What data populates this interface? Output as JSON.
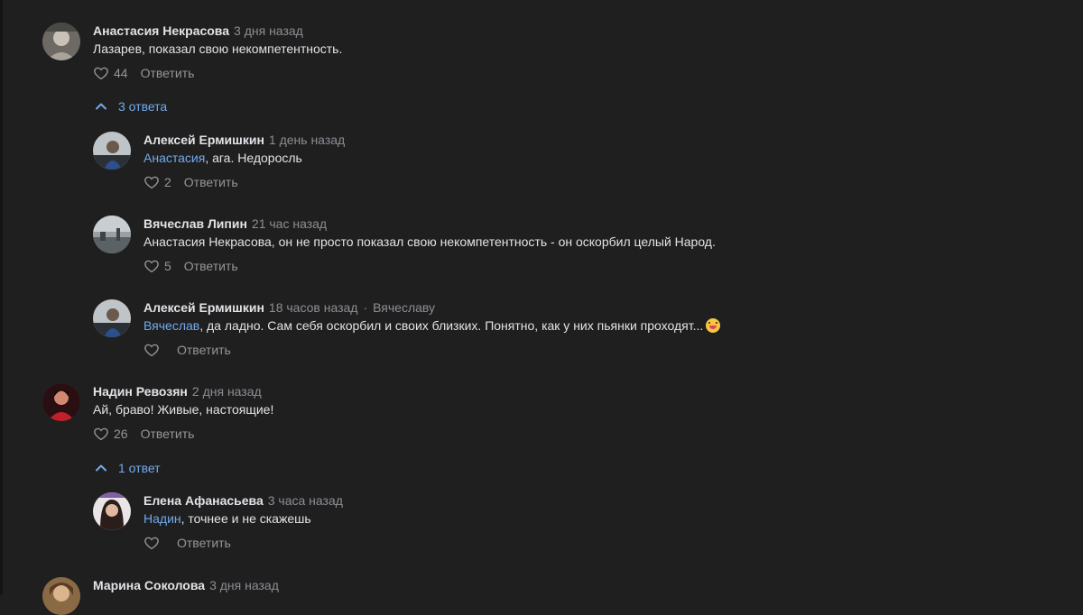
{
  "colors": {
    "background": "#1f1f20",
    "link": "#71aaeb",
    "meta": "#8b8e93",
    "text": "#e1e3e6"
  },
  "comments": [
    {
      "author": "Анастасия Некрасова",
      "time": "3 дня назад",
      "text": "Лазарев, показал свою некомпетентность.",
      "likes": "44",
      "reply_label": "Ответить",
      "toggle_label": "3 ответа",
      "replies": [
        {
          "author": "Алексей Ермишкин",
          "time": "1 день назад",
          "mention": "Анастасия",
          "text": ", ага. Недоросль",
          "likes": "2",
          "reply_label": "Ответить"
        },
        {
          "author": "Вячеслав Липин",
          "time": "21 час назад",
          "text": "Анастасия Некрасова, он не просто показал свою некомпетентность - он оскорбил целый Народ.",
          "likes": "5",
          "reply_label": "Ответить"
        },
        {
          "author": "Алексей Ермишкин",
          "time": "18 часов назад",
          "reply_to": "Вячеславу",
          "mention": "Вячеслав",
          "text": ", да ладно. Сам себя оскорбил и своих близких. Понятно, как у них пьянки проходят...",
          "emoji": "grinning-tongue-emoji",
          "reply_label": "Ответить"
        }
      ]
    },
    {
      "author": "Надин Ревозян",
      "time": "2 дня назад",
      "text": "Ай, браво! Живые, настоящие!",
      "likes": "26",
      "reply_label": "Ответить",
      "toggle_label": "1 ответ",
      "replies": [
        {
          "author": "Елена Афанасьева",
          "time": "3 часа назад",
          "mention": "Надин",
          "text": ", точнее и не скажешь",
          "reply_label": "Ответить"
        }
      ]
    },
    {
      "author": "Марина Соколова",
      "time": "3 дня назад"
    }
  ]
}
